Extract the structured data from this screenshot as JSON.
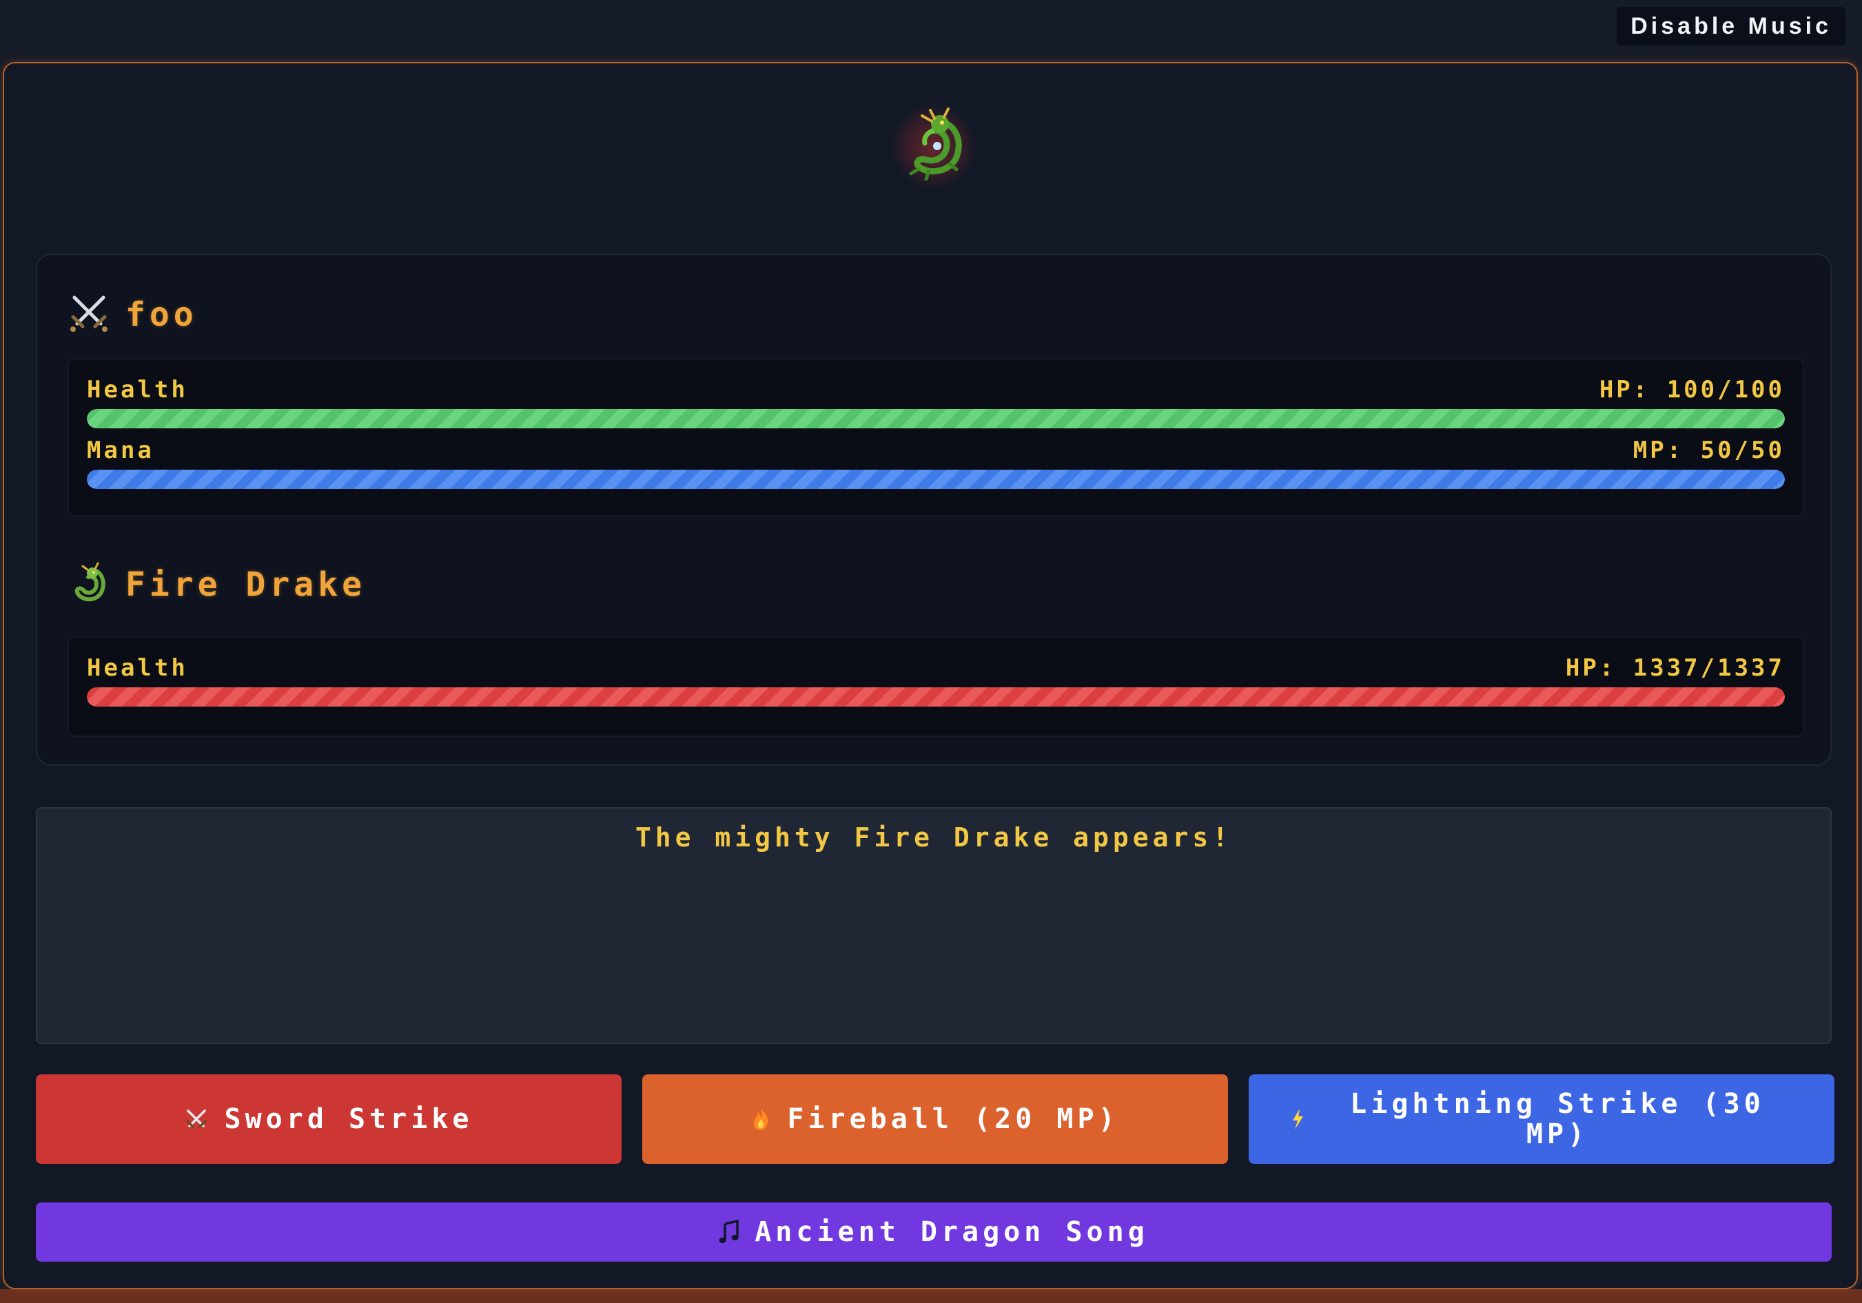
{
  "topbar": {
    "music_toggle_label": "Disable Music"
  },
  "player": {
    "name": "foo",
    "icon": "crossed-swords-icon",
    "health": {
      "label": "Health",
      "text": "HP: 100/100",
      "value": 100,
      "max": 100,
      "color": "#55c36c"
    },
    "mana": {
      "label": "Mana",
      "text": "MP: 50/50",
      "value": 50,
      "max": 50,
      "color": "#3f7be6"
    }
  },
  "enemy": {
    "name": "Fire Drake",
    "icon": "dragon-icon",
    "health": {
      "label": "Health",
      "text": "HP: 1337/1337",
      "value": 1337,
      "max": 1337,
      "color": "#dc3f3f"
    }
  },
  "battle_log": {
    "message": "The mighty Fire Drake appears!"
  },
  "actions": [
    {
      "label": "Sword Strike",
      "icon": "crossed-swords-icon",
      "color": "#cc3633"
    },
    {
      "label": "Fireball (20 MP)",
      "icon": "fire-icon",
      "color": "#dc622d"
    },
    {
      "label": "Lightning Strike (30 MP)",
      "icon": "lightning-icon",
      "color": "#3c66e3"
    }
  ],
  "special": {
    "label": "Ancient Dragon Song",
    "icon": "music-note-icon",
    "color": "#7138e0"
  }
}
